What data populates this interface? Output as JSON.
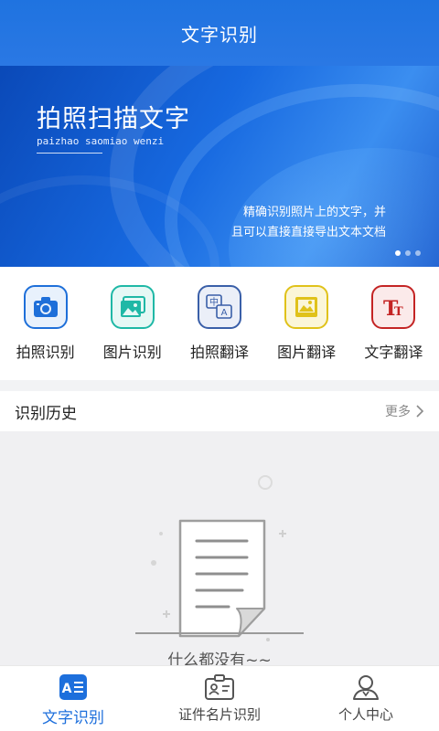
{
  "header": {
    "title": "文字识别"
  },
  "banner": {
    "title": "拍照扫描文字",
    "subtitle": "paizhao saomiao wenzi",
    "desc_line1": "精确识别照片上的文字，并",
    "desc_line2": "且可以直接直接导出文本文档",
    "slides": 3,
    "active_slide": 1
  },
  "features": [
    {
      "label": "拍照识别",
      "icon": "camera-icon",
      "color": "#1e6fd9"
    },
    {
      "label": "图片识别",
      "icon": "image-icon",
      "color": "#1fb8a6"
    },
    {
      "label": "拍照翻译",
      "icon": "translate-icon",
      "color": "#3a5fa8"
    },
    {
      "label": "图片翻译",
      "icon": "picture-translate-icon",
      "color": "#e0c21a"
    },
    {
      "label": "文字翻译",
      "icon": "text-translate-icon",
      "color": "#c42424"
    }
  ],
  "history": {
    "title": "识别历史",
    "more": "更多"
  },
  "empty": {
    "text": "什么都没有~~"
  },
  "tabs": [
    {
      "label": "文字识别",
      "icon": "text-recognition-icon",
      "active": true
    },
    {
      "label": "证件名片识别",
      "icon": "id-card-icon",
      "active": false
    },
    {
      "label": "个人中心",
      "icon": "person-icon",
      "active": false
    }
  ],
  "colors": {
    "primary": "#1d6fdc",
    "header": "#2474e2"
  }
}
